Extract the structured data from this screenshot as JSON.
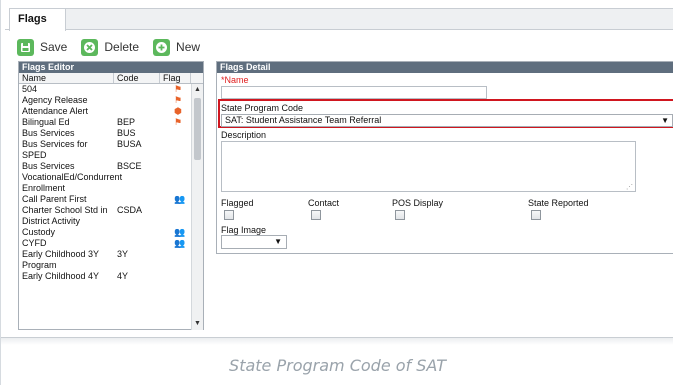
{
  "tab": {
    "label": "Flags"
  },
  "toolbar": {
    "save_label": "Save",
    "delete_label": "Delete",
    "new_label": "New"
  },
  "editor": {
    "title": "Flags Editor",
    "columns": [
      "Name",
      "Code",
      "Flag"
    ],
    "rows": [
      {
        "name": "504",
        "code": "",
        "flag": "flag-icon"
      },
      {
        "name": "Agency Release",
        "code": "",
        "flag": "flag-icon"
      },
      {
        "name": "Attendance Alert",
        "code": "",
        "flag": "bell-icon"
      },
      {
        "name": "Bilingual Ed",
        "code": "BEP",
        "flag": "flag-icon"
      },
      {
        "name": "Bus Services",
        "code": "BUS",
        "flag": ""
      },
      {
        "name": "Bus Services for SPED",
        "code": "BUSA",
        "flag": ""
      },
      {
        "name": "Bus Services VocationalEd/Condurrent Enrollment",
        "code": "BSCE",
        "flag": ""
      },
      {
        "name": "Call Parent First",
        "code": "",
        "flag": "people-icon"
      },
      {
        "name": "Charter School Std in District Activity",
        "code": "CSDA",
        "flag": ""
      },
      {
        "name": "Custody",
        "code": "",
        "flag": "people-icon"
      },
      {
        "name": "CYFD",
        "code": "",
        "flag": "people-icon"
      },
      {
        "name": "Early Childhood 3Y Program",
        "code": "3Y",
        "flag": ""
      },
      {
        "name": "Early Childhood 4Y",
        "code": "4Y",
        "flag": ""
      }
    ]
  },
  "detail": {
    "title": "Flags Detail",
    "name_label": "*Name",
    "name_value": "",
    "state_program_code_label": "State Program Code",
    "state_program_code_value": "SAT: Student Assistance Team Referral",
    "description_label": "Description",
    "flagged_label": "Flagged",
    "contact_label": "Contact",
    "pos_display_label": "POS Display",
    "state_reported_label": "State Reported",
    "flag_image_label": "Flag Image",
    "flag_image_value": ""
  },
  "caption": "State Program Code of SAT",
  "colors": {
    "panel_header": "#5f6e7e",
    "accent_green": "#5cb85c",
    "flag_orange": "#e8632a",
    "highlight_red": "#d0161f"
  }
}
